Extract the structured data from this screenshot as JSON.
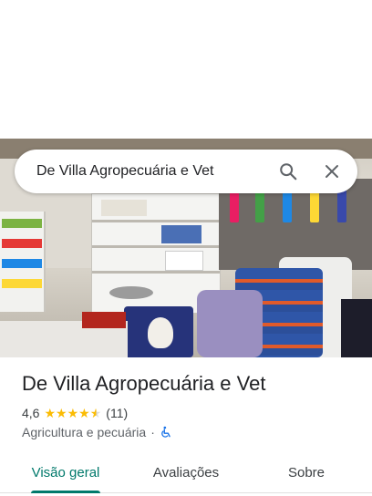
{
  "search": {
    "query": "De Villa Agropecuária e Vet"
  },
  "place": {
    "name": "De Villa Agropecuária e Vet",
    "rating": "4,6",
    "rating_value": 4.6,
    "reviews_count": "(11)",
    "category": "Agricultura e pecuária",
    "separator": "·"
  },
  "tabs": [
    {
      "label": "Visão geral",
      "selected": true
    },
    {
      "label": "Avaliações",
      "selected": false
    },
    {
      "label": "Sobre",
      "selected": false
    }
  ],
  "colors": {
    "accent": "#00796b",
    "star": "#fbbc04",
    "accessibility_icon": "#1a73e8"
  },
  "icons": {
    "search": "search-icon",
    "close": "close-icon",
    "accessibility": "wheelchair-accessible-icon"
  }
}
